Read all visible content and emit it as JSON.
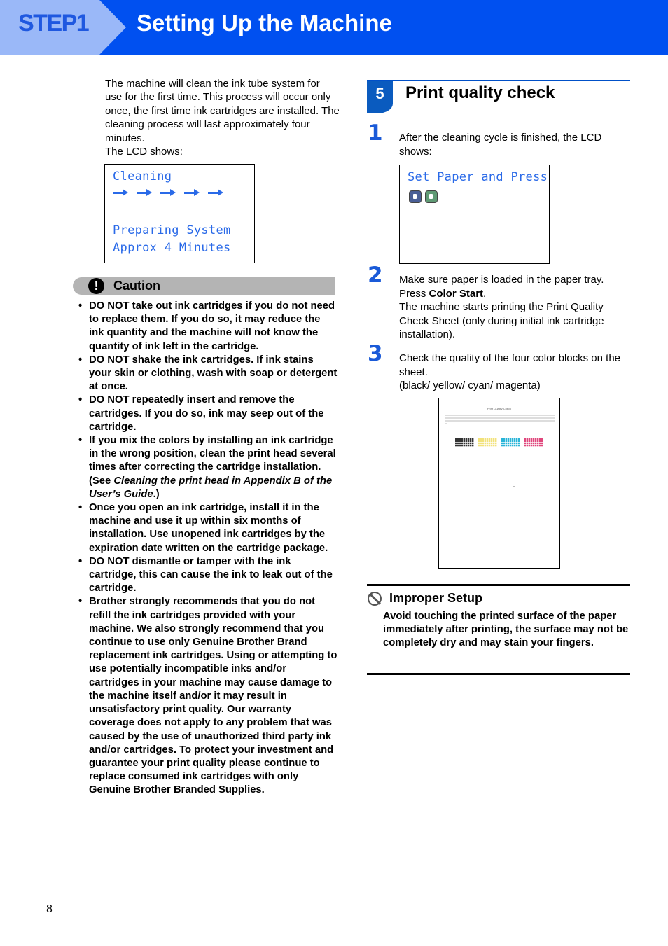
{
  "header": {
    "step_label": "STEP1",
    "title": "Setting Up the Machine",
    "colors": {
      "bar": "#0050f0",
      "tab": "#9ab8f8",
      "tab_text": "#1f58e0"
    }
  },
  "left": {
    "intro_lines": [
      "The machine will clean the ink tube system for use for the first time. This process will occur only once, the first time ink cartridges are installed. The cleaning process will last approximately four minutes.",
      "The LCD shows:"
    ],
    "lcd": {
      "line1": "Cleaning",
      "progress_arrows": 5,
      "line3": "Preparing System",
      "line4": "Approx 4 Minutes"
    },
    "caution": {
      "icon": "exclamation-icon",
      "label": "Caution",
      "items": [
        {
          "text": "DO NOT take out ink cartridges if you do not need to replace them. If you do so, it may reduce the ink quantity and the machine will not know the quantity of ink left in the cartridge."
        },
        {
          "text": "DO NOT shake the ink cartridges. If ink stains your skin or clothing, wash with soap or detergent at once."
        },
        {
          "text": "DO NOT repeatedly insert and remove the cartridges. If you do so, ink may seep out of the cartridge."
        },
        {
          "text_before": "If you mix the colors by installing an ink cartridge in the wrong position, clean the print head several times after correcting the cartridge installation. (See ",
          "italic": "Cleaning the print head in Appendix B of the User’s Guide",
          "text_after": ".)"
        },
        {
          "text": "Once you open an ink cartridge, install it in the machine and use it up within six months of installation. Use unopened ink cartridges by the expiration date written on the cartridge package."
        },
        {
          "text": "DO NOT dismantle or tamper with the ink cartridge, this can cause the ink to leak out of the cartridge."
        },
        {
          "text": "Brother strongly recommends that you do not refill the ink cartridges provided with your machine. We also strongly recommend that you continue to use only Genuine Brother Brand replacement ink cartridges. Using or attempting to use potentially incompatible inks and/or cartridges in your machine may cause damage to the machine itself and/or it may result in unsatisfactory print quality. Our warranty coverage does not apply to any problem that was caused by the use of unauthorized third party ink and/or cartridges. To protect your investment and guarantee your print quality please continue to replace consumed ink cartridges with only Genuine Brother Branded Supplies."
        }
      ]
    }
  },
  "section": {
    "number": "5",
    "title": "Print quality check",
    "steps": [
      {
        "num": "1",
        "text": "After the cleaning cycle is finished, the LCD shows:"
      },
      {
        "num": "2",
        "line1": "Make sure paper is loaded in the paper tray.",
        "press_prefix": "Press ",
        "press_bold": "Color Start",
        "press_suffix": ".",
        "line3": "The machine starts printing the Print Quality Check Sheet (only during initial ink cartridge installation)."
      },
      {
        "num": "3",
        "line1": "Check the quality of the four color blocks on the sheet.",
        "line2": "(black/ yellow/ cyan/ magenta)"
      }
    ],
    "lcd": {
      "line1": "Set Paper and Press",
      "buttons": [
        {
          "name": "mono-start-button-icon",
          "color": "#4a5f96"
        },
        {
          "name": "color-start-button-icon",
          "color": "#5f9a74"
        }
      ]
    },
    "sheet": {
      "title": "Print Quality Check",
      "blocks": [
        {
          "name": "black",
          "color": "#333333"
        },
        {
          "name": "yellow",
          "color": "#f2e27a"
        },
        {
          "name": "cyan",
          "color": "#28b4d8"
        },
        {
          "name": "magenta",
          "color": "#e0467c"
        }
      ]
    }
  },
  "improper": {
    "icon": "prohibited-icon",
    "title": "Improper Setup",
    "body": "Avoid touching the printed surface of the paper immediately after printing, the surface may not be completely dry and may stain your fingers."
  },
  "footer": {
    "page_number": "8"
  }
}
